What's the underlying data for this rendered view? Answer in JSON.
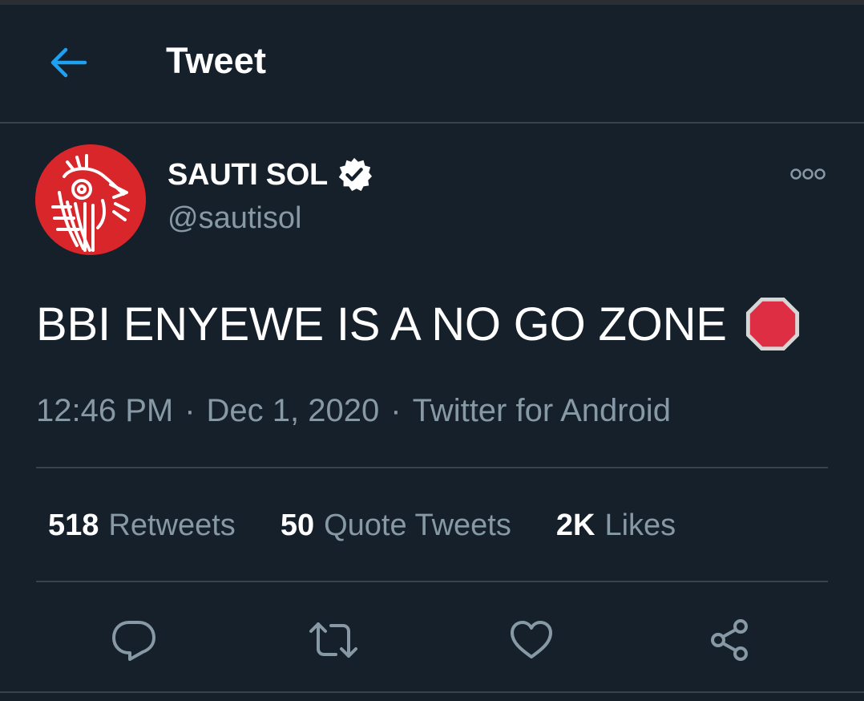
{
  "header": {
    "title": "Tweet",
    "back_icon": "arrow-left-icon"
  },
  "tweet": {
    "display_name": "SAUTI SOL",
    "handle": "@sautisol",
    "verified_icon": "verified-badge-icon",
    "text": "BBI ENYEWE IS A NO GO ZONE",
    "emoji": "stop-sign-emoji",
    "time": "12:46 PM",
    "date": "Dec 1, 2020",
    "separator": "·",
    "source": "Twitter for Android"
  },
  "stats": {
    "retweets_count": "518",
    "retweets_label": "Retweets",
    "quotes_count": "50",
    "quotes_label": "Quote Tweets",
    "likes_count": "2K",
    "likes_label": "Likes"
  },
  "actions": [
    "reply-icon",
    "retweet-icon",
    "like-icon",
    "share-icon"
  ],
  "colors": {
    "background": "#15202b",
    "accent": "#1da1f2",
    "secondary_text": "#8899a6",
    "divider": "#38444d",
    "avatar_red": "#d8262a",
    "stop_red": "#dd2e44"
  }
}
